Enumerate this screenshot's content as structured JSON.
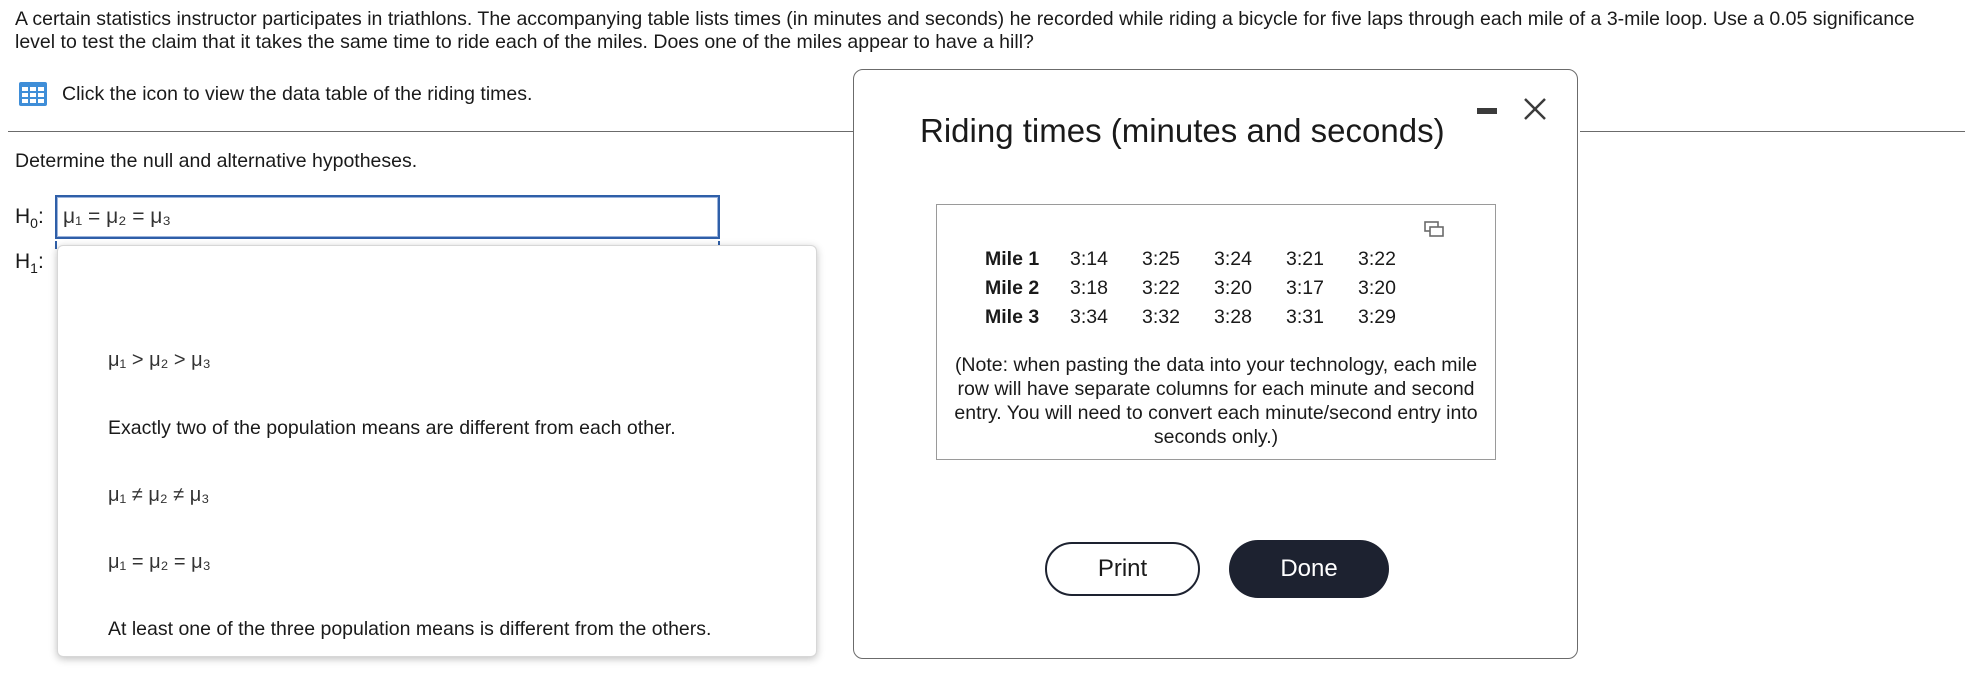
{
  "question": {
    "text": "A certain statistics instructor participates in triathlons. The accompanying table lists times (in minutes and seconds) he recorded while riding a bicycle for five laps through each mile of a 3-mile loop. Use a 0.05 significance level to test the claim that it takes the same time to ride each of the miles. Does one of the miles appear to have a hill?"
  },
  "data_link": {
    "icon": "table-icon",
    "label": "Click the icon to view the data table of the riding times."
  },
  "hypotheses": {
    "prompt": "Determine the null and alternative hypotheses.",
    "h0_label": "H",
    "h0_sub": "0",
    "h1_label": "H",
    "h1_sub": "1",
    "colon": ":",
    "h0_value": "μ₁ = μ₂ = μ₃",
    "dropdown_options": [
      "μ₁ > μ₂ > μ₃",
      "Exactly two of the population means are different from each other.",
      "μ₁ ≠ μ₂ ≠ μ₃",
      "μ₁ = μ₂ = μ₃",
      "At least one of the three population means is different from the others."
    ]
  },
  "dialog": {
    "title": "Riding times (minutes and seconds)",
    "minimize_icon": "minimize-icon",
    "close_icon": "close-icon",
    "copy_icon": "copy-icon",
    "rows": [
      {
        "label": "Mile 1",
        "values": [
          "3:14",
          "3:25",
          "3:24",
          "3:21",
          "3:22"
        ]
      },
      {
        "label": "Mile 2",
        "values": [
          "3:18",
          "3:22",
          "3:20",
          "3:17",
          "3:20"
        ]
      },
      {
        "label": "Mile 3",
        "values": [
          "3:34",
          "3:32",
          "3:28",
          "3:31",
          "3:29"
        ]
      }
    ],
    "note": "(Note: when pasting the data into your technology, each mile row will have separate columns for each minute and second entry. You will need to convert each minute/second entry into seconds only.)",
    "print_label": "Print",
    "done_label": "Done"
  },
  "colors": {
    "accent_blue": "#2f5fa8",
    "dark_button": "#1d2230"
  }
}
